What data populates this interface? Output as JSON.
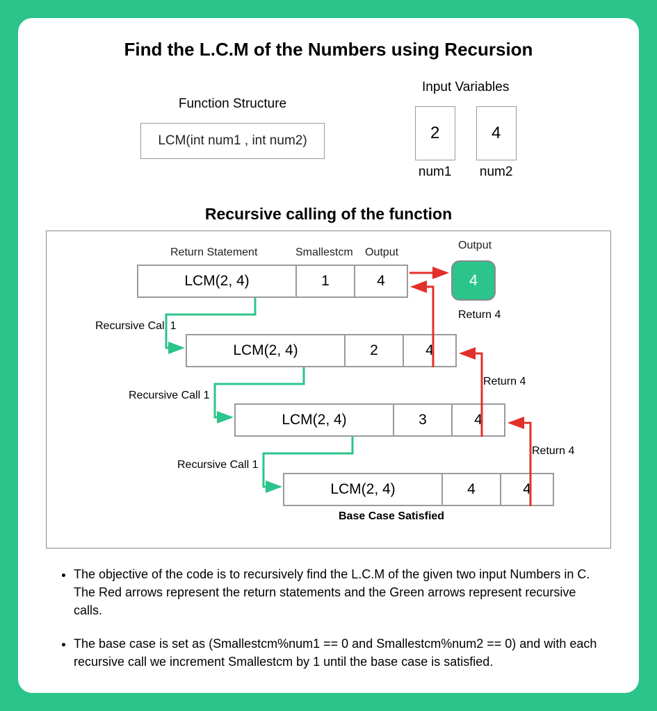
{
  "title": "Find the L.C.M of the Numbers using Recursion",
  "func": {
    "label": "Function Structure",
    "text": "LCM(int num1 , int num2)"
  },
  "vars": {
    "label": "Input Variables",
    "items": [
      {
        "value": "2",
        "name": "num1"
      },
      {
        "value": "4",
        "name": "num2"
      }
    ]
  },
  "subtitle": "Recursive calling of the function",
  "headers": {
    "return": "Return Statement",
    "smallest": "Smallestcm",
    "output_col": "Output",
    "output_badge": "Output"
  },
  "calls": [
    {
      "fn": "LCM(2, 4)",
      "sm": "1",
      "out": "4"
    },
    {
      "fn": "LCM(2, 4)",
      "sm": "2",
      "out": "4"
    },
    {
      "fn": "LCM(2, 4)",
      "sm": "3",
      "out": "4"
    },
    {
      "fn": "LCM(2, 4)",
      "sm": "4",
      "out": "4"
    }
  ],
  "output_value": "4",
  "labels": {
    "rec1": "Recursive Call 1",
    "rec2": "Recursive Call 1",
    "rec3": "Recursive Call 1",
    "ret1": "Return 4",
    "ret2": "Return 4",
    "ret3": "Return 4",
    "base": "Base Case Satisfied"
  },
  "bullets": [
    "The objective of the code is to recursively find the L.C.M of the given two input Numbers in C. The Red arrows represent the return statements and the Green arrows represent recursive calls.",
    "The base case is set as (Smallestcm%num1 == 0 and Smallestcm%num2 == 0) and with each recursive call we increment Smallestcm by 1 until the base case is satisfied."
  ],
  "colors": {
    "green": "#2BC48A",
    "red": "#E2302B"
  }
}
